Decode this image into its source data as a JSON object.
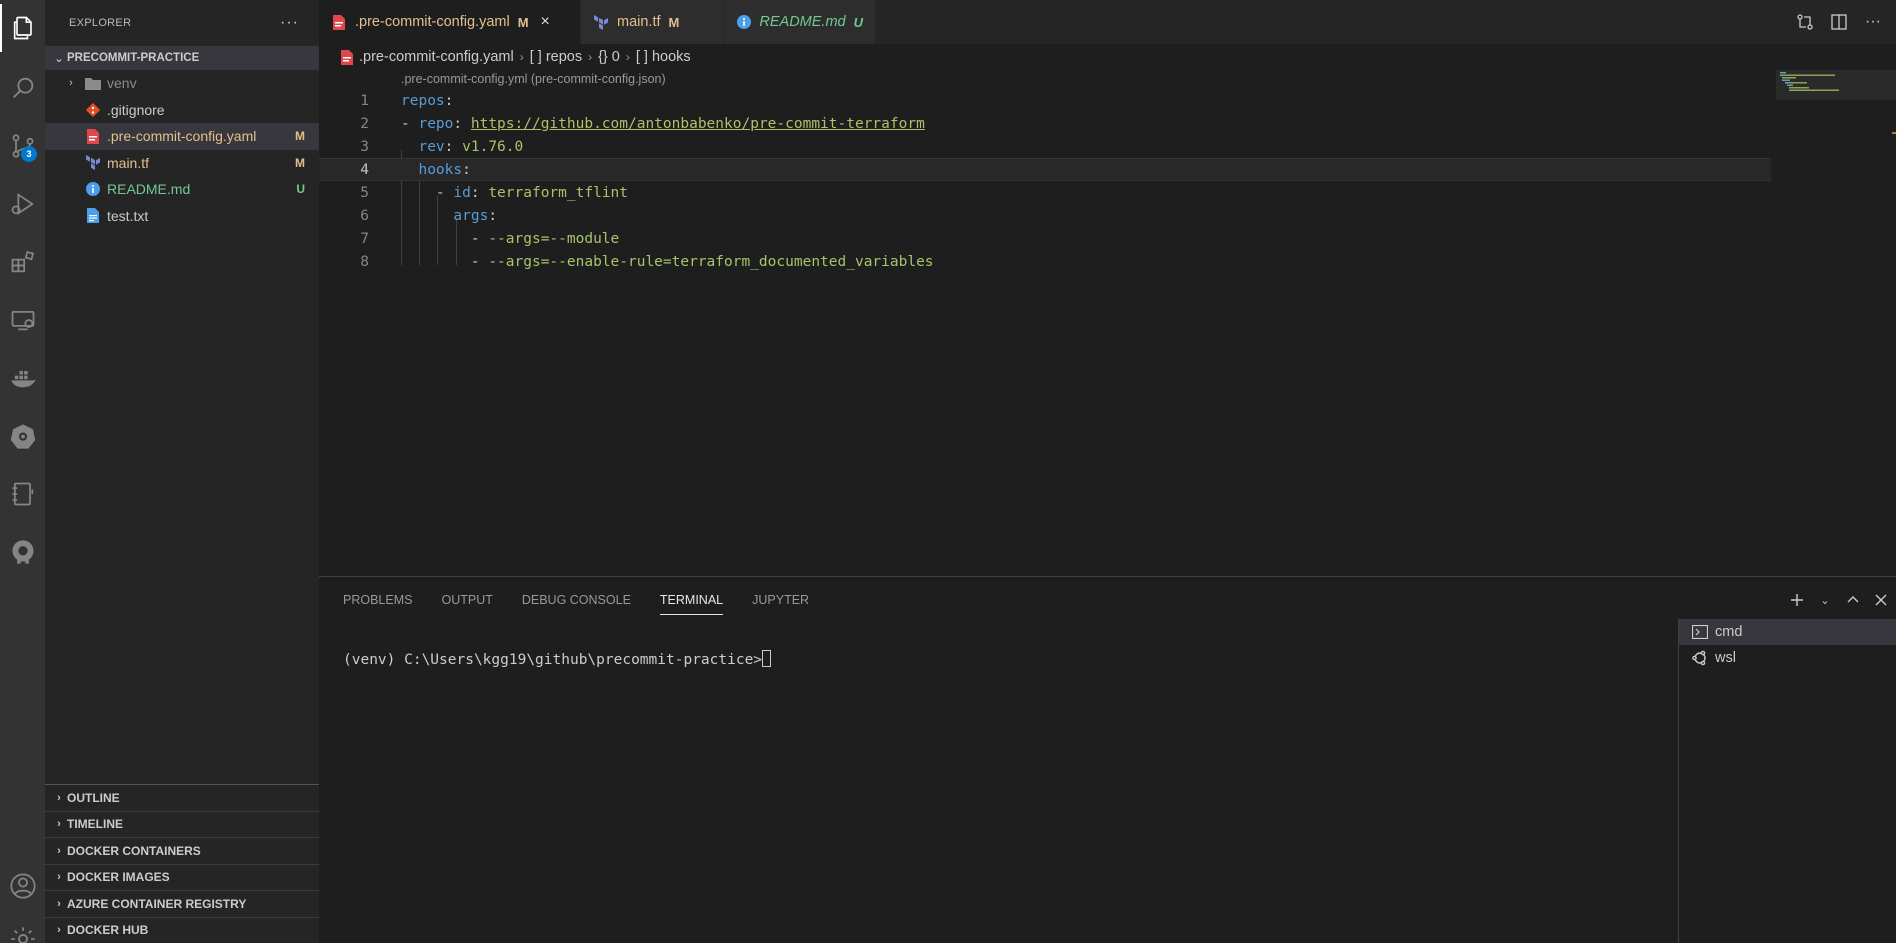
{
  "activity_bar": {
    "items": [
      {
        "name": "explorer-icon"
      },
      {
        "name": "search-icon"
      },
      {
        "name": "source-control-icon",
        "badge": "3"
      },
      {
        "name": "run-debug-icon"
      },
      {
        "name": "extensions-icon"
      },
      {
        "name": "remote-explorer-icon"
      },
      {
        "name": "docker-icon"
      },
      {
        "name": "kubernetes-icon"
      },
      {
        "name": "notebook-icon"
      },
      {
        "name": "gitkraken-icon"
      },
      {
        "name": "account-icon"
      },
      {
        "name": "settings-gear-icon"
      }
    ]
  },
  "sidebar": {
    "title": "EXPLORER",
    "more": "···",
    "project": "PRECOMMIT-PRACTICE",
    "files": [
      {
        "name": "venv",
        "type": "folder",
        "status": "",
        "color": "#8b8b8b"
      },
      {
        "name": ".gitignore",
        "type": "git",
        "status": "",
        "color": "#cccccc"
      },
      {
        "name": ".pre-commit-config.yaml",
        "type": "yaml",
        "status": "M",
        "color": "#e2c08d"
      },
      {
        "name": "main.tf",
        "type": "terraform",
        "status": "M",
        "color": "#e2c08d"
      },
      {
        "name": "README.md",
        "type": "info",
        "status": "U",
        "color": "#73c991"
      },
      {
        "name": "test.txt",
        "type": "text",
        "status": "",
        "color": "#cccccc"
      }
    ],
    "sections": [
      "OUTLINE",
      "TIMELINE",
      "DOCKER CONTAINERS",
      "DOCKER IMAGES",
      "AZURE CONTAINER REGISTRY",
      "DOCKER HUB"
    ]
  },
  "tabs": [
    {
      "label": ".pre-commit-config.yaml",
      "status": "M",
      "active": true,
      "close": "×"
    },
    {
      "label": "main.tf",
      "status": "M",
      "active": false
    },
    {
      "label": "README.md",
      "status": "U",
      "active": false
    }
  ],
  "breadcrumb": {
    "file": ".pre-commit-config.yaml",
    "seg1": "[ ] repos",
    "seg2": "{} 0",
    "seg3": "[ ] hooks"
  },
  "editor": {
    "codelens": ".pre-commit-config.yml (pre-commit-config.json)",
    "current_line": 4,
    "line_numbers": [
      "1",
      "2",
      "3",
      "4",
      "5",
      "6",
      "7",
      "8"
    ],
    "lines": {
      "l1_key": "repos",
      "l2_key": "repo",
      "l2_value": "https://github.com/antonbabenko/pre-commit-terraform",
      "l3_key": "rev",
      "l3_value": "v1.76.0",
      "l4_key": "hooks",
      "l5_key": "id",
      "l5_value": "terraform_tflint",
      "l6_key": "args",
      "l7_value": "--args=--module",
      "l8_value": "--args=--enable-rule=terraform_documented_variables"
    }
  },
  "panel": {
    "tabs": [
      "PROBLEMS",
      "OUTPUT",
      "DEBUG CONSOLE",
      "TERMINAL",
      "JUPYTER"
    ],
    "active_tab": "TERMINAL",
    "terminal_prompt": "(venv) C:\\Users\\kgg19\\github\\precommit-practice>",
    "terminals": [
      "cmd",
      "wsl"
    ]
  }
}
